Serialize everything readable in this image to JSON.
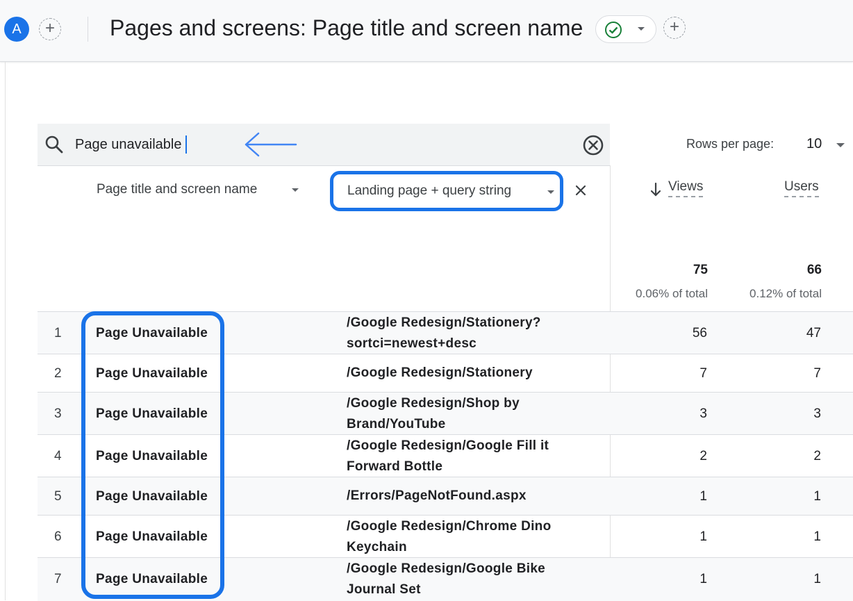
{
  "header": {
    "avatar_letter": "A",
    "report_title": "Pages and screens: Page title and screen name",
    "add_comparison_icon": "plus-icon",
    "status_icon": "check-circle-icon"
  },
  "search": {
    "value": "Page unavailable",
    "clear_icon": "close-circle-icon"
  },
  "pagination": {
    "rows_label": "Rows per page:",
    "rows_value": "10"
  },
  "columns": {
    "primary": "Page title and screen name",
    "secondary": "Landing page + query string",
    "views": "Views",
    "users": "Users"
  },
  "totals": {
    "views": "75",
    "views_pct": "0.06% of total",
    "users": "66",
    "users_pct": "0.12% of total"
  },
  "rows": [
    {
      "idx": "1",
      "page": "Page Unavailable",
      "landing": "/Google Redesign/Stationery?sortci=newest+desc",
      "views": "56",
      "users": "47"
    },
    {
      "idx": "2",
      "page": "Page Unavailable",
      "landing": "/Google Redesign/Stationery",
      "views": "7",
      "users": "7"
    },
    {
      "idx": "3",
      "page": "Page Unavailable",
      "landing": "/Google Redesign/Shop by Brand/YouTube",
      "views": "3",
      "users": "3"
    },
    {
      "idx": "4",
      "page": "Page Unavailable",
      "landing": "/Google Redesign/Google Fill it Forward Bottle",
      "views": "2",
      "users": "2"
    },
    {
      "idx": "5",
      "page": "Page Unavailable",
      "landing": "/Errors/PageNotFound.aspx",
      "views": "1",
      "users": "1"
    },
    {
      "idx": "6",
      "page": "Page Unavailable",
      "landing": "/Google Redesign/Chrome Dino Keychain",
      "views": "1",
      "users": "1"
    },
    {
      "idx": "7",
      "page": "Page Unavailable",
      "landing": "/Google Redesign/Google Bike Journal Set",
      "views": "1",
      "users": "1"
    }
  ],
  "colors": {
    "accent": "#1a73e8",
    "status_green": "#188038"
  }
}
